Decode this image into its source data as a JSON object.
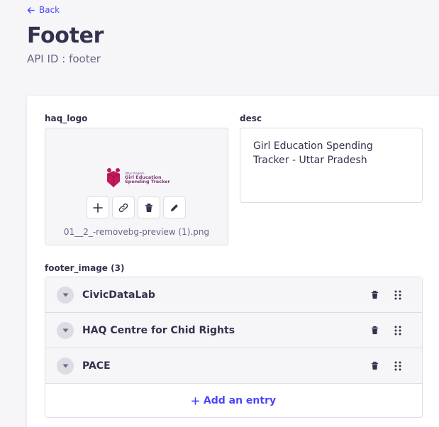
{
  "header": {
    "back_label": "Back",
    "title": "Footer",
    "api_id": "API ID : footer"
  },
  "fields": {
    "haq_logo": {
      "label": "haq_logo",
      "file_name": "01__2_-removebg-preview (1).png",
      "logo_small_text": "Uttar Pradesh",
      "logo_line1": "Girl Education",
      "logo_line2": "Spending Tracker",
      "actions": [
        "add-icon",
        "link-icon",
        "trash-icon",
        "pencil-icon"
      ]
    },
    "desc": {
      "label": "desc",
      "value": "Girl Education Spending Tracker - Uttar Pradesh"
    },
    "footer_image": {
      "label": "footer_image (3)",
      "entries": [
        {
          "title": "CivicDataLab"
        },
        {
          "title": "HAQ Centre for Chid Rights"
        },
        {
          "title": "PACE"
        }
      ],
      "add_label": "Add an entry"
    }
  },
  "colors": {
    "accent": "#4945ff",
    "text": "#32324d",
    "muted": "#666687",
    "border": "#dcdce4",
    "page_bg": "#f6f6f9"
  }
}
